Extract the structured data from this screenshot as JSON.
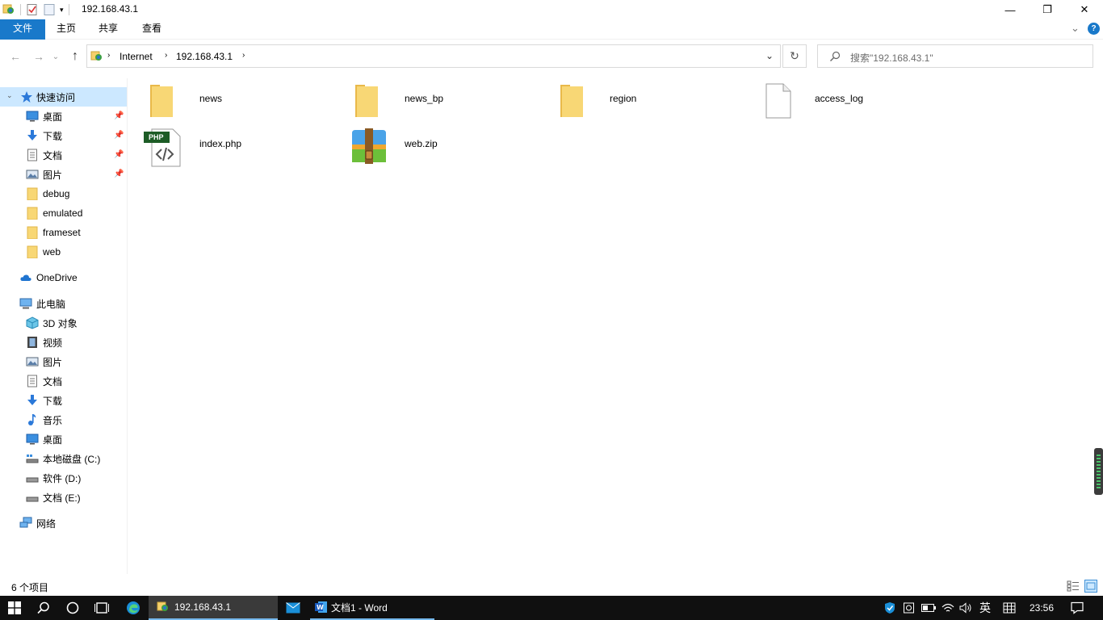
{
  "window": {
    "title": "192.168.43.1",
    "controls": {
      "minimize": "—",
      "restore": "❐",
      "close": "✕"
    }
  },
  "ribbon": {
    "tabs": [
      {
        "label": "文件"
      },
      {
        "label": "主页"
      },
      {
        "label": "共享"
      },
      {
        "label": "查看"
      }
    ],
    "expand": "⌄",
    "help": "?"
  },
  "navigation": {
    "back": "←",
    "forward": "→",
    "recent": "⌄",
    "up": "↑"
  },
  "address": {
    "segments": [
      "Internet",
      "192.168.43.1"
    ],
    "refresh": "↻"
  },
  "search": {
    "placeholder": "搜索\"192.168.43.1\""
  },
  "sidebar": {
    "quick_access": {
      "label": "快速访问",
      "items": [
        {
          "label": "桌面",
          "icon": "desktop-icon",
          "pinned": true
        },
        {
          "label": "下载",
          "icon": "download-icon",
          "pinned": true
        },
        {
          "label": "文档",
          "icon": "document-icon",
          "pinned": true
        },
        {
          "label": "图片",
          "icon": "picture-icon",
          "pinned": true
        },
        {
          "label": "debug",
          "icon": "folder-icon",
          "pinned": false
        },
        {
          "label": "emulated",
          "icon": "folder-icon",
          "pinned": false
        },
        {
          "label": "frameset",
          "icon": "folder-icon",
          "pinned": false
        },
        {
          "label": "web",
          "icon": "folder-icon",
          "pinned": false
        }
      ]
    },
    "onedrive": {
      "label": "OneDrive"
    },
    "this_pc": {
      "label": "此电脑",
      "items": [
        {
          "label": "3D 对象",
          "icon": "3d-objects-icon"
        },
        {
          "label": "视频",
          "icon": "video-icon"
        },
        {
          "label": "图片",
          "icon": "picture-icon"
        },
        {
          "label": "文档",
          "icon": "document-icon"
        },
        {
          "label": "下载",
          "icon": "download-icon"
        },
        {
          "label": "音乐",
          "icon": "music-icon"
        },
        {
          "label": "桌面",
          "icon": "desktop-icon"
        },
        {
          "label": "本地磁盘 (C:)",
          "icon": "drive-icon"
        },
        {
          "label": "软件 (D:)",
          "icon": "drive-icon"
        },
        {
          "label": "文档 (E:)",
          "icon": "drive-icon"
        }
      ]
    },
    "network": {
      "label": "网络"
    }
  },
  "files": [
    {
      "name": "news",
      "type": "folder"
    },
    {
      "name": "news_bp",
      "type": "folder"
    },
    {
      "name": "region",
      "type": "folder"
    },
    {
      "name": "access_log",
      "type": "file"
    },
    {
      "name": "index.php",
      "type": "php"
    },
    {
      "name": "web.zip",
      "type": "zip"
    }
  ],
  "php_badge": "PHP",
  "status": {
    "count": "6 个项目"
  },
  "taskbar": {
    "apps": [
      {
        "label": "192.168.43.1"
      },
      {
        "label": "文档1 - Word"
      }
    ],
    "ime": "英",
    "clock": "23:56"
  },
  "colors": {
    "accent": "#1979ca",
    "selection": "#cce8ff",
    "folder": "#f8d775",
    "taskbar": "#101010"
  }
}
